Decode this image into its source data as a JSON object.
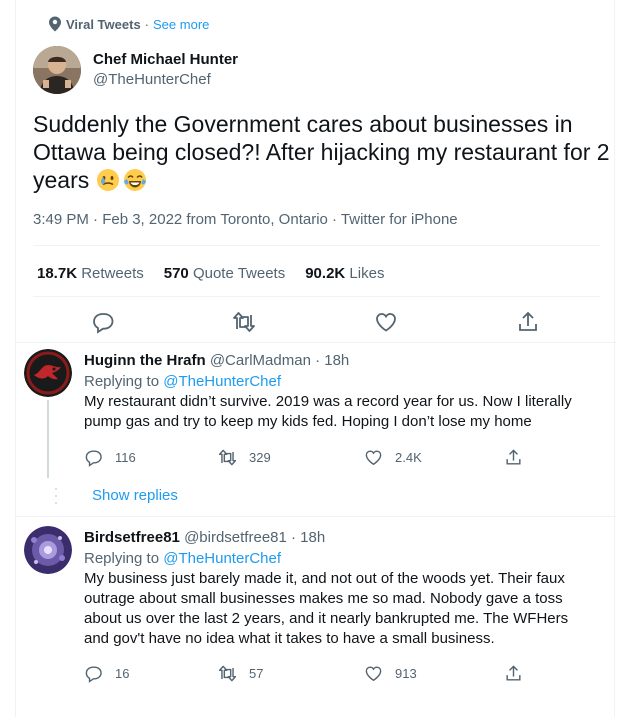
{
  "context": {
    "label": "Viral Tweets",
    "separator": "·",
    "see_more": "See more"
  },
  "tweet": {
    "author_name": "Chef Michael Hunter",
    "author_handle": "@TheHunterChef",
    "text": "Suddenly the Government cares about businesses in Ottawa being closed?! After hijacking my restaurant for 2 years",
    "emojis": [
      "sad-smile-emoji",
      "tears-of-joy-emoji"
    ],
    "timestamp": "3:49 PM · Feb 3, 2022 from Toronto, Ontario · Twitter for iPhone",
    "stats": {
      "retweets_count": "18.7K",
      "retweets_label": "Retweets",
      "quotes_count": "570",
      "quotes_label": "Quote Tweets",
      "likes_count": "90.2K",
      "likes_label": "Likes"
    }
  },
  "replies": [
    {
      "name": "Huginn the Hrafn",
      "handle_time": "@CarlMadman · 18h",
      "replying_prefix": "Replying to",
      "replying_to": "@TheHunterChef",
      "text": "My restaurant didn’t survive. 2019 was a record year for us. Now I literally pump gas and try to keep my kids fed. Hoping I don’t lose my home",
      "reply_count": "116",
      "retweet_count": "329",
      "like_count": "2.4K"
    },
    {
      "name": "Birdsetfree81",
      "handle_time": "@birdsetfree81 · 18h",
      "replying_prefix": "Replying to",
      "replying_to": "@TheHunterChef",
      "text": "My business just barely made it, and not out of the woods yet. Their faux outrage about small businesses makes me so mad. Nobody gave a toss about us over the last 2 years, and it nearly bankrupted me. The WFHers and gov't have no idea what it takes to have a small business.",
      "reply_count": "16",
      "retweet_count": "57",
      "like_count": "913"
    }
  ],
  "show_replies": "Show replies",
  "icons": {
    "reply": "reply-icon",
    "retweet": "retweet-icon",
    "like": "heart-icon",
    "share": "share-icon",
    "pin": "location-pin-icon"
  },
  "colors": {
    "accent": "#1d9bf0",
    "secondary": "#536471",
    "primary": "#0f1419",
    "divider": "#eff3f4"
  }
}
